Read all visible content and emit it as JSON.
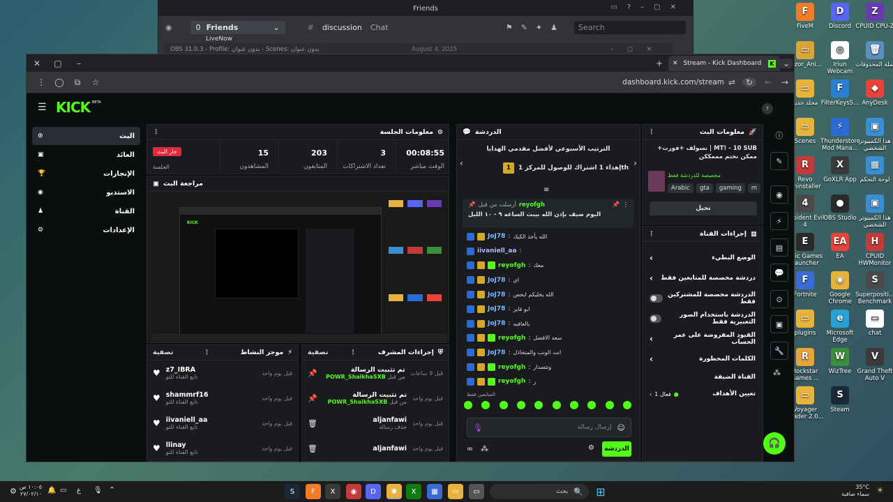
{
  "discord": {
    "title": "Friends",
    "friends_label": "Friends",
    "friends_count": "0",
    "live_label": "LiveNow",
    "channel": "discussion",
    "chat_label": "Chat",
    "search_placeholder": "Search",
    "date": "August 4, 2025"
  },
  "obs": {
    "title": "OBS 31.0.3 - Profile: بدون عنوان - Scenes: بدون عنوان"
  },
  "browser": {
    "tab_title": "Stream - Kick Dashboard",
    "url": "dashboard.kick.com/stream"
  },
  "kick": {
    "logo": "KICK",
    "logo_beta": "BETA",
    "sidebar": [
      {
        "label": "البث",
        "icon": "broadcast-icon"
      },
      {
        "label": "العائد",
        "icon": "wallet-icon"
      },
      {
        "label": "الإنجازات",
        "icon": "trophy-icon"
      },
      {
        "label": "الاستديو",
        "icon": "studio-icon"
      },
      {
        "label": "القناة",
        "icon": "channel-icon"
      },
      {
        "label": "الإعدادات",
        "icon": "gear-icon"
      }
    ],
    "session": {
      "title": "معلومات الجلسة",
      "live_badge": "جار البث",
      "session_label": "الجلسة",
      "stats": [
        {
          "value": "00:08:55",
          "label": "الوقت مباشر"
        },
        {
          "value": "3",
          "label": "تعداد الاشتراكات"
        },
        {
          "value": "203",
          "label": "المتابعون"
        },
        {
          "value": "15",
          "label": "المشاهدون"
        }
      ]
    },
    "preview": {
      "title": "مراجعة البث"
    },
    "activity": {
      "title": "موجز النشاط",
      "filter": "تصفية",
      "items": [
        {
          "user": "z7_IBRA",
          "desc": "تابع القناة للتو",
          "time": "قبل يوم واحد"
        },
        {
          "user": "shammrf16",
          "desc": "تابع القناة للتو",
          "time": "قبل يوم واحد"
        },
        {
          "user": "iivaniell_aa",
          "desc": "تابع القناة للتو",
          "time": "قبل يوم واحد"
        },
        {
          "user": "llinay",
          "desc": "تابع القناة للتو",
          "time": "قبل يوم واحد"
        }
      ]
    },
    "modactions": {
      "title": "إجراءات المشرف",
      "filter": "تصفية",
      "items": [
        {
          "action": "تم تثبيت الرسالة",
          "by_prefix": "من قبل",
          "by": "POWR_ShaikhaSXB",
          "time": "قبل 9 ساعات",
          "icon": "pin-icon"
        },
        {
          "action": "تم تثبيت الرسالة",
          "by_prefix": "من قبل",
          "by": "POWR_ShaikhaSXB",
          "time": "قبل يوم واحد",
          "icon": "pin-icon"
        },
        {
          "action": "aljanfawi",
          "by_prefix": "حذف رسالة",
          "by": "",
          "time": "قبل يوم واحد",
          "icon": "trash-icon"
        },
        {
          "action": "aljanfawi",
          "by_prefix": "",
          "by": "",
          "time": "قبل يوم واحد",
          "icon": "trash-icon"
        }
      ]
    },
    "chat": {
      "title": "الدردشة",
      "leaderboard": "الترتيب الأسبوعي لأفضل مقدمي الهدايا",
      "leader_rank": "1",
      "leader_text": "إهداء 1 اشتراك للوصول للمركز 1th",
      "pinned_by_label": "أرسلت من قبل",
      "pinned_user": "reyofgh",
      "pinned_text": "اليوم ضيف بإذن الله بيبث الساعه ٩ - ١٠ الليل",
      "messages": [
        {
          "user": "JoJ78",
          "text": "الله يأخذ الكيك",
          "cls": "u2"
        },
        {
          "user": "iivaniell_aa",
          "text": "",
          "cls": "u3"
        },
        {
          "user": "reyofgh",
          "text": "معك",
          "cls": "u1"
        },
        {
          "user": "JoJ78",
          "text": "اي",
          "cls": "u2"
        },
        {
          "user": "JoJ78",
          "text": "الله يخليكم ابحص",
          "cls": "u2"
        },
        {
          "user": "JoJ78",
          "text": "ابو فايز",
          "cls": "u2"
        },
        {
          "user": "JoJ78",
          "text": "بالعافيه",
          "cls": "u2"
        },
        {
          "user": "reyofgh",
          "text": "سعد الافضل",
          "cls": "u1"
        },
        {
          "user": "JoJ78",
          "text": "انت الونب والمتخاذل",
          "cls": "u2"
        },
        {
          "user": "reyofgh",
          "text": "وتتصدار",
          "cls": "u1"
        },
        {
          "user": "reyofgh",
          "text": "ر",
          "cls": "u1"
        }
      ],
      "followers_only": "المتابعين فقط",
      "input_placeholder": "إرسال رسالة",
      "send": "الدردشة"
    },
    "streaminfo": {
      "title": "معلومات البث",
      "stream_title": "MT! - 10 SUB | نسولف +فورت+ ممكن نختم مممككن",
      "subtitle": "مخصصة للدردشة فقط",
      "tags": [
        "Arabic",
        "gta",
        "gaming",
        "m"
      ],
      "edit": "تحيل"
    },
    "channelactions": {
      "title": "إجراءات القناة",
      "rows": [
        {
          "label": "الوضع البطيء",
          "type": "arrow"
        },
        {
          "label": "دردشة مخصصة للمتابعين فقط",
          "type": "arrow"
        },
        {
          "label": "الدردشة مخصصة للمشتركين فقط",
          "type": "toggle"
        },
        {
          "label": "الدردشة باستخدام الصور التعبيرية فقط",
          "type": "toggle"
        },
        {
          "label": "القيود المفروضة على عمر الحساب",
          "type": "arrow"
        },
        {
          "label": "الكلمات المحظورة",
          "type": "arrow"
        }
      ],
      "guest_label": "القناة الضيفة",
      "goals_label": "تعيين الأهداف",
      "goals_value": "فعال 1"
    }
  },
  "desktop_icons": [
    {
      "label": "FiveM",
      "color": "#f07c2a",
      "glyph": "F"
    },
    {
      "label": "Discord",
      "color": "#5865f2",
      "glyph": "D"
    },
    {
      "label": "CPUID CPU-Z",
      "color": "#6a3bb0",
      "glyph": "Z"
    },
    {
      "label": "razor_Ani...",
      "color": "#d9a43a",
      "glyph": "▭"
    },
    {
      "label": "Iriun Webcam",
      "color": "#ffffff",
      "glyph": "◎"
    },
    {
      "label": "سلة المحذوفات",
      "color": "#5a8fbf",
      "glyph": "🗑"
    },
    {
      "label": "مجلد جديد",
      "color": "#e8b33b",
      "glyph": "▭"
    },
    {
      "label": "FilterKeysS...",
      "color": "#2a7fd4",
      "glyph": "F"
    },
    {
      "label": "AnyDesk",
      "color": "#e8423a",
      "glyph": "◆"
    },
    {
      "label": "Scenes",
      "color": "#e8b33b",
      "glyph": "▭"
    },
    {
      "label": "Thunderstore Mod Mana...",
      "color": "#2a6ad4",
      "glyph": "⚡"
    },
    {
      "label": "هذا الكمبيوتر الشخصي",
      "color": "#3a8fd4",
      "glyph": "▣"
    },
    {
      "label": "Revo Uninstaller",
      "color": "#c23a3a",
      "glyph": "R"
    },
    {
      "label": "GoXLR App",
      "color": "#3a3a3a",
      "glyph": "X"
    },
    {
      "label": "لوحة التحكم",
      "color": "#3a8fd4",
      "glyph": "▦"
    },
    {
      "label": "Resident Evil 4",
      "color": "#4a4a4a",
      "glyph": "4"
    },
    {
      "label": "OBS Studio",
      "color": "#2a2a2a",
      "glyph": "●"
    },
    {
      "label": "هذا الكمبيوتر الشخصي",
      "color": "#3a8fd4",
      "glyph": "▣"
    },
    {
      "label": "Epic Games Launcher",
      "color": "#2a2a2a",
      "glyph": "E"
    },
    {
      "label": "EA",
      "color": "#e8423a",
      "glyph": "EA"
    },
    {
      "label": "CPUID HWMonitor",
      "color": "#c23a3a",
      "glyph": "H"
    },
    {
      "label": "Fortnite",
      "color": "#3a6ad4",
      "glyph": "F"
    },
    {
      "label": "Google Chrome",
      "color": "#e8b33b",
      "glyph": "◉"
    },
    {
      "label": "Superpositi... Benchmark",
      "color": "#4a4a4a",
      "glyph": "S"
    },
    {
      "label": "plugins",
      "color": "#e8b33b",
      "glyph": "▭"
    },
    {
      "label": "Microsoft Edge",
      "color": "#2a9fd4",
      "glyph": "e"
    },
    {
      "label": "chat",
      "color": "#ffffff",
      "glyph": "▭"
    },
    {
      "label": "Rockstar Games ...",
      "color": "#e8a33b",
      "glyph": "R"
    },
    {
      "label": "WizTree",
      "color": "#3a8f3a",
      "glyph": "W"
    },
    {
      "label": "Grand Theft Auto V",
      "color": "#3a3a3a",
      "glyph": "V"
    },
    {
      "label": "Voyager shader 2.0...",
      "color": "#e8b33b",
      "glyph": "▭"
    },
    {
      "label": "Steam",
      "color": "#1b2838",
      "glyph": "S"
    }
  ],
  "taskbar": {
    "search_placeholder": "بحث",
    "weather_temp": "35°C",
    "weather_desc": "سماء صافية",
    "time": "١٠:٠٥ ص",
    "date": "٢٧/٠٢/١٠",
    "lang": "ع"
  }
}
